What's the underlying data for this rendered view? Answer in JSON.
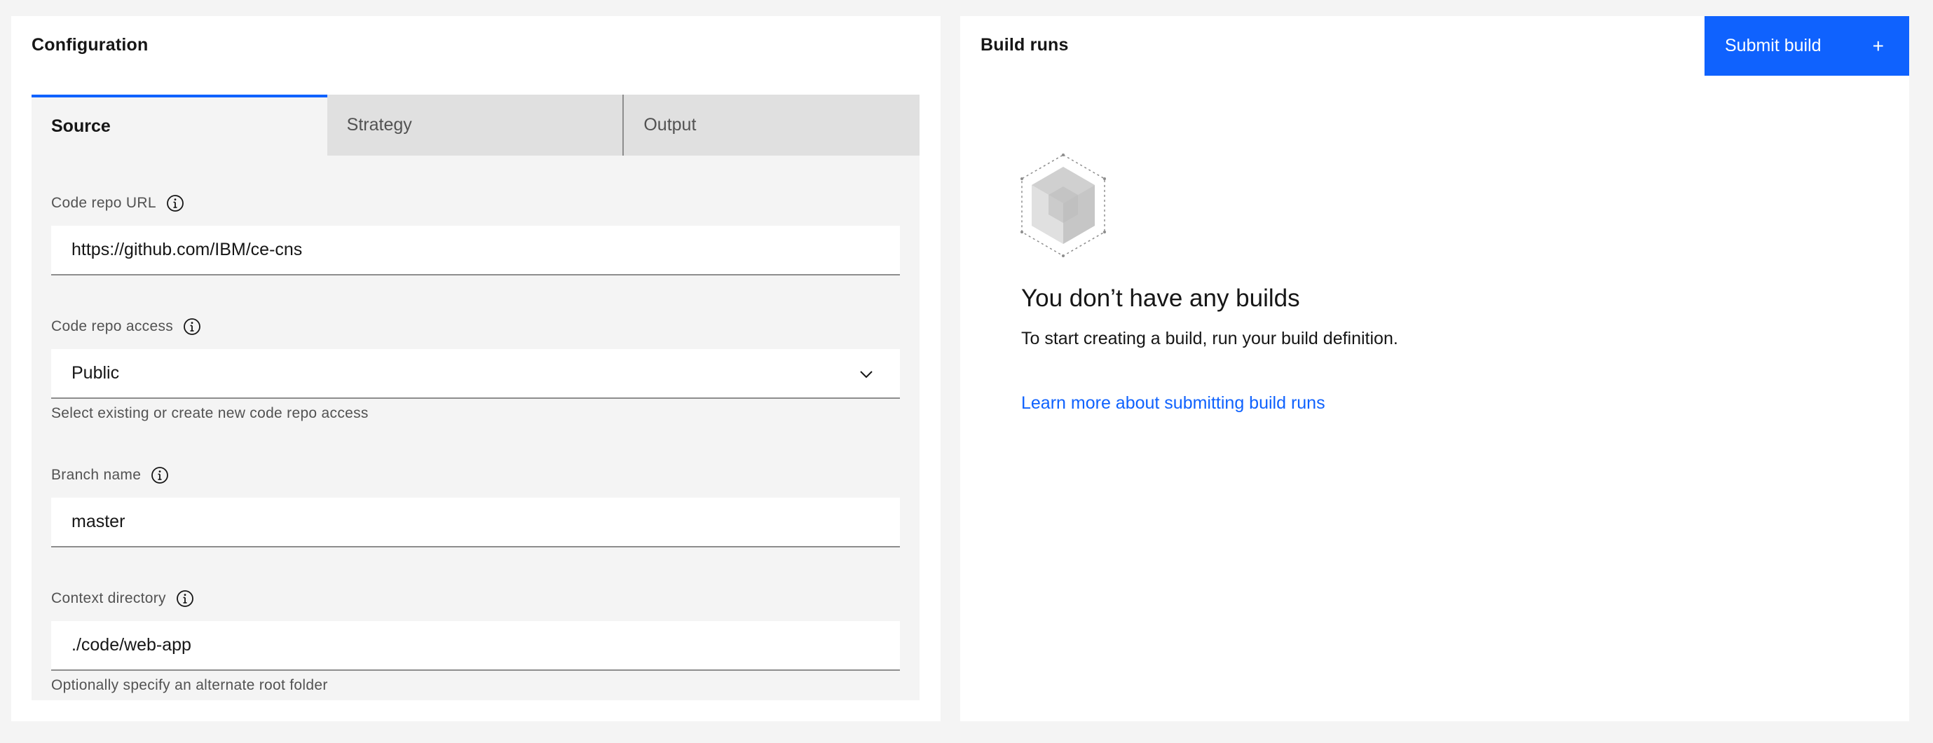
{
  "configuration": {
    "title": "Configuration",
    "tabs": [
      {
        "label": "Source",
        "active": true
      },
      {
        "label": "Strategy",
        "active": false
      },
      {
        "label": "Output",
        "active": false
      }
    ],
    "fields": {
      "code_repo_url": {
        "label": "Code repo URL",
        "value": "https://github.com/IBM/ce-cns"
      },
      "code_repo_access": {
        "label": "Code repo access",
        "value": "Public",
        "helper": "Select existing or create new code repo access"
      },
      "branch_name": {
        "label": "Branch name",
        "value": "master"
      },
      "context_directory": {
        "label": "Context directory",
        "value": "./code/web-app",
        "helper": "Optionally specify an alternate root folder"
      }
    }
  },
  "build_runs": {
    "title": "Build runs",
    "submit_label": "Submit build",
    "submit_icon": "+",
    "empty_title": "You don’t have any builds",
    "empty_description": "To start creating a build, run your build definition.",
    "learn_more_link": "Learn more about submitting build runs"
  },
  "colors": {
    "accent": "#0f62fe",
    "background": "#f4f4f4",
    "tab_inactive": "#e0e0e0"
  },
  "icons": [
    "information-icon",
    "chevron-down-icon",
    "add-icon",
    "empty-state-cube-icon"
  ]
}
